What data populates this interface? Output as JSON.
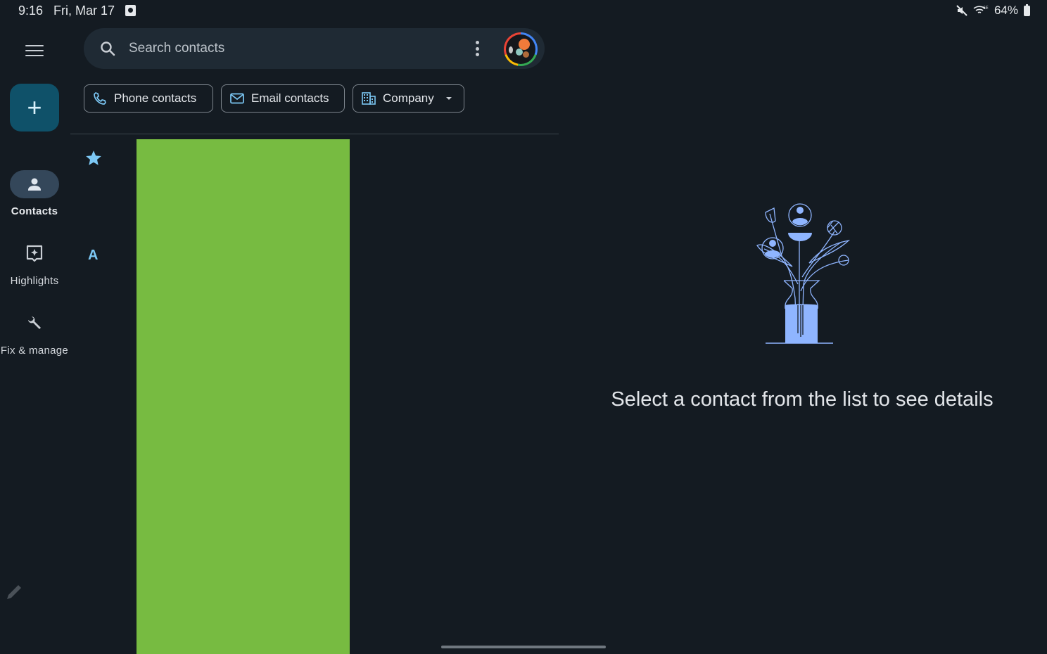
{
  "status_bar": {
    "time": "9:16",
    "date": "Fri, Mar 17",
    "notification_icon": "screen-record-icon",
    "icons": [
      "mute-icon",
      "wifi-6e-icon"
    ],
    "battery": "64%"
  },
  "nav_rail": {
    "menu_icon": "hamburger-menu-icon",
    "fab_icon": "plus-icon",
    "items": [
      {
        "label": "Contacts",
        "icon": "person-icon",
        "active": true
      },
      {
        "label": "Highlights",
        "icon": "highlights-icon",
        "active": false
      },
      {
        "label": "Fix & manage",
        "icon": "wrench-icon",
        "active": false
      }
    ],
    "edit_icon": "pencil-icon"
  },
  "search": {
    "placeholder": "Search contacts",
    "more_icon": "more-vertical-icon",
    "avatar": "account-avatar"
  },
  "filter_chips": [
    {
      "label": "Phone contacts",
      "icon": "phone-icon"
    },
    {
      "label": "Email contacts",
      "icon": "mail-icon"
    },
    {
      "label": "Company",
      "icon": "building-icon",
      "dropdown": true
    }
  ],
  "contact_list": {
    "sections": [
      {
        "header": "starred",
        "icon": "star-icon"
      },
      {
        "header": "A"
      }
    ],
    "redacted_block_color": "#77bb41"
  },
  "detail_pane": {
    "illustration": "vase-with-contacts-illustration",
    "empty_message": "Select a contact from the list to see details"
  },
  "colors": {
    "background": "#141b22",
    "accent": "#7cc8f5",
    "fab": "#0f5169",
    "illustration": "#8fb5ff"
  }
}
